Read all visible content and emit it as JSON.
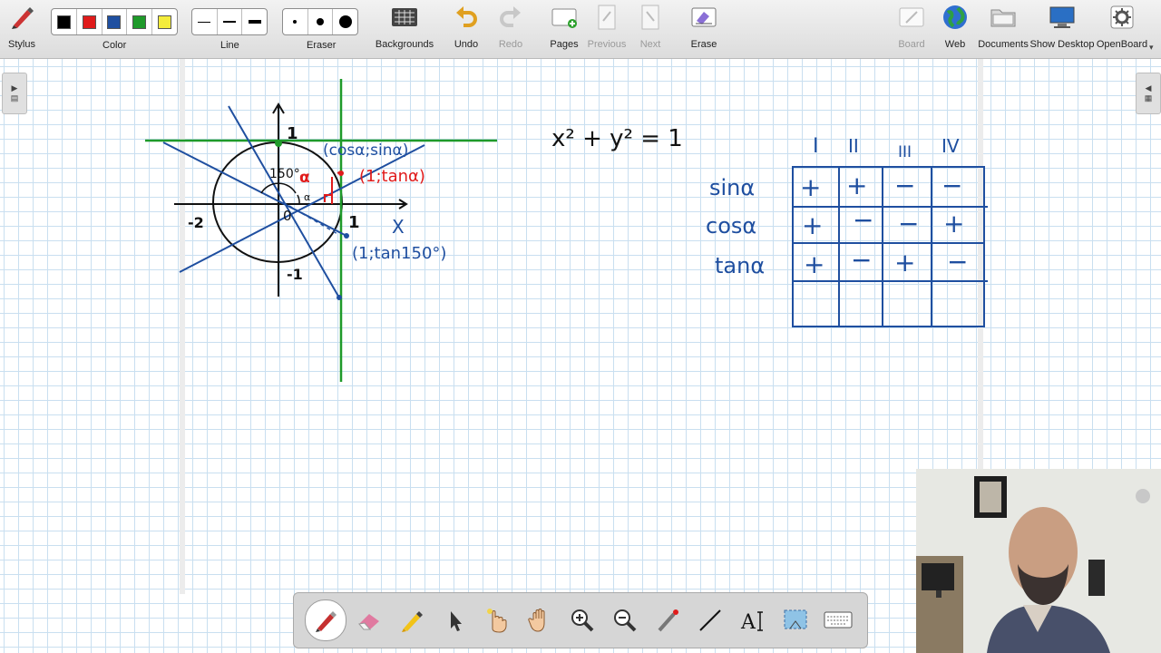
{
  "toolbar": {
    "stylus": "Stylus",
    "color": "Color",
    "line": "Line",
    "eraser": "Eraser",
    "backgrounds": "Backgrounds",
    "undo": "Undo",
    "redo": "Redo",
    "pages": "Pages",
    "previous": "Previous",
    "next": "Next",
    "erase": "Erase",
    "board": "Board",
    "web": "Web",
    "documents": "Documents",
    "show_desktop": "Show Desktop",
    "openboard": "OpenBoard",
    "colors": [
      "#000000",
      "#e01b1b",
      "#1f4fa0",
      "#1f9a2a",
      "#f4ec3b"
    ]
  },
  "board": {
    "unit_circle": {
      "y_top": "1",
      "x_left": "-2",
      "origin": "0",
      "x_right": "1",
      "x_axis": "X",
      "y_bottom": "-1",
      "angle_150": "150°",
      "angle_alpha": "α",
      "point_cos_sin": "(cosα;sinα)",
      "point_1_tan": "(1;tanα)",
      "point_1_tan150": "(1;tan150°)"
    },
    "equation": "x² + y² = 1",
    "sign_table": {
      "quadrants": [
        "I",
        "II",
        "III",
        "IV"
      ],
      "rows": [
        {
          "label": "sinα",
          "signs": [
            "+",
            "+",
            "−",
            "−"
          ]
        },
        {
          "label": "cosα",
          "signs": [
            "+",
            "−",
            "−",
            "+"
          ]
        },
        {
          "label": "tanα",
          "signs": [
            "+",
            "−",
            "+",
            "−"
          ]
        },
        {
          "label": "",
          "signs": [
            "",
            "",
            "",
            ""
          ]
        }
      ]
    }
  },
  "bottom_tools": [
    "pen-icon",
    "eraser-icon",
    "marker-icon",
    "selector-icon",
    "interactor-icon",
    "hand-icon",
    "zoom-in-icon",
    "zoom-out-icon",
    "laser-pointer-icon",
    "line-icon",
    "text-icon",
    "capture-icon",
    "keyboard-icon"
  ],
  "colors": {
    "ink_blue": "#1f4fa0",
    "ink_green": "#1f9a2a",
    "ink_red": "#e01b1b",
    "ink_black": "#1a1a1a",
    "grid": "#c9dff0"
  }
}
